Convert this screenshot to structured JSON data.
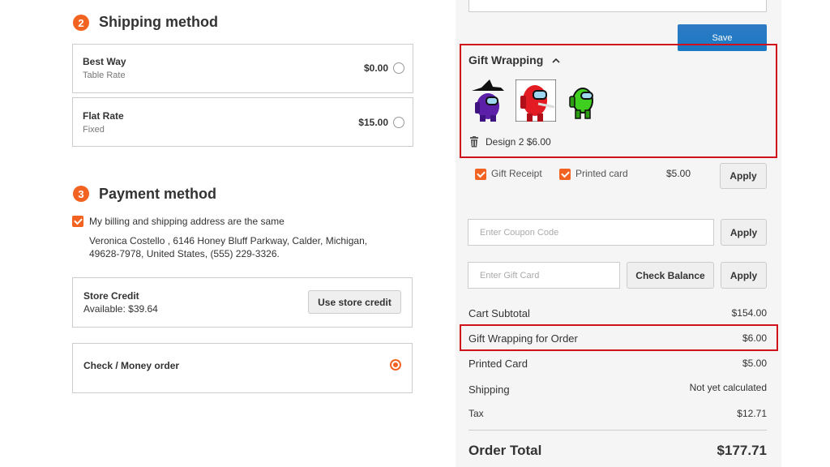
{
  "shipping": {
    "step_number": "2",
    "title": "Shipping method",
    "options": [
      {
        "name": "Best Way",
        "sub": "Table Rate",
        "price": "$0.00"
      },
      {
        "name": "Flat Rate",
        "sub": "Fixed",
        "price": "$15.00"
      }
    ]
  },
  "payment": {
    "step_number": "3",
    "title": "Payment method",
    "same_address_label": "My billing and shipping address are the same",
    "address_line1": "Veronica Costello , 6146 Honey Bluff Parkway, Calder, Michigan,",
    "address_line2": "49628-7978, United States, (555) 229-3326.",
    "store_credit_title": "Store Credit",
    "store_credit_available": "Available: $39.64",
    "use_store_credit_label": "Use store credit",
    "check_money_label": "Check / Money order"
  },
  "sidebar": {
    "save_label": "Save",
    "gift_wrapping_title": "Gift Wrapping",
    "selected_design": "Design 2 $6.00",
    "gift_receipt_label": "Gift Receipt",
    "printed_card_label": "Printed card",
    "printed_card_price": "$5.00",
    "apply_label": "Apply",
    "coupon_placeholder": "Enter Coupon Code",
    "gift_card_placeholder": "Enter Gift Card",
    "check_balance_label": "Check Balance"
  },
  "totals": {
    "rows": [
      {
        "label": "Cart Subtotal",
        "value": "$154.00"
      },
      {
        "label": "Gift Wrapping for Order",
        "value": "$6.00"
      },
      {
        "label": "Printed Card",
        "value": "$5.00"
      },
      {
        "label": "Shipping",
        "value": "Not yet calculated"
      },
      {
        "label": "Tax",
        "value": "$12.71"
      }
    ],
    "order_total_label": "Order Total",
    "order_total_value": "$177.71"
  },
  "colors": {
    "accent": "#f26322",
    "highlight": "#d0101a",
    "primary_button": "#1979c3"
  },
  "icons": [
    "chevron-up-icon",
    "trash-icon",
    "checkmark-icon"
  ]
}
